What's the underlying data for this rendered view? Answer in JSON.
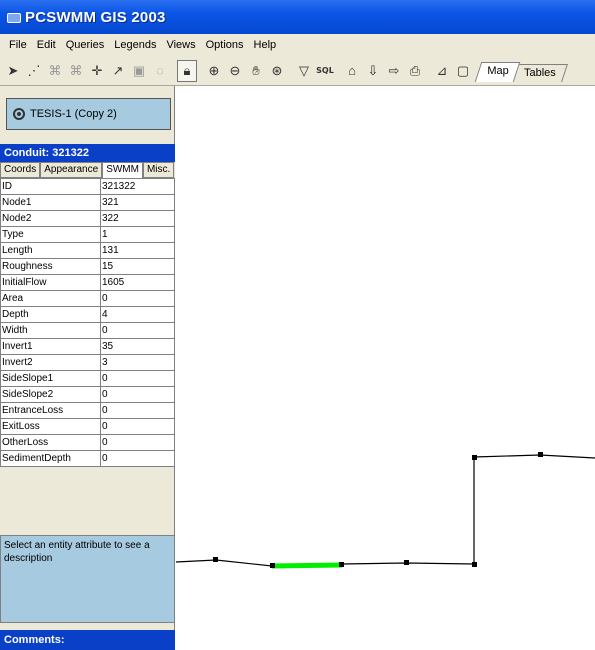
{
  "window": {
    "title": "PCSWMM GIS 2003"
  },
  "menu": [
    "File",
    "Edit",
    "Queries",
    "Legends",
    "Views",
    "Options",
    "Help"
  ],
  "toolbar": {
    "sql_label": "SQL",
    "tabs": [
      {
        "label": "Map",
        "active": true
      },
      {
        "label": "Tables",
        "active": false
      }
    ]
  },
  "project": {
    "name": "TESIS-1 (Copy 2)"
  },
  "conduit": {
    "header": "Conduit: 321322",
    "tabs": [
      "Coords",
      "Appearance",
      "SWMM",
      "Misc."
    ],
    "active_tab": "SWMM",
    "properties": [
      {
        "key": "ID",
        "value": "321322"
      },
      {
        "key": "Node1",
        "value": "321"
      },
      {
        "key": "Node2",
        "value": "322"
      },
      {
        "key": "Type",
        "value": "1"
      },
      {
        "key": "Length",
        "value": "131"
      },
      {
        "key": "Roughness",
        "value": "15"
      },
      {
        "key": "InitialFlow",
        "value": "1605"
      },
      {
        "key": "Area",
        "value": "0"
      },
      {
        "key": "Depth",
        "value": "4"
      },
      {
        "key": "Width",
        "value": "0"
      },
      {
        "key": "Invert1",
        "value": "35"
      },
      {
        "key": "Invert2",
        "value": "3"
      },
      {
        "key": "SideSlope1",
        "value": "0"
      },
      {
        "key": "SideSlope2",
        "value": "0"
      },
      {
        "key": "EntranceLoss",
        "value": "0"
      },
      {
        "key": "ExitLoss",
        "value": "0"
      },
      {
        "key": "OtherLoss",
        "value": "0"
      },
      {
        "key": "SedimentDepth",
        "value": "0"
      }
    ],
    "description": "Select an entity attribute to see a description"
  },
  "comments": {
    "header": "Comments:"
  },
  "colors": {
    "titlebar": "#0a55e6",
    "panel_header": "#0a3fc7",
    "selected_conduit": "#00ee00",
    "info_box": "#a6cadf"
  }
}
